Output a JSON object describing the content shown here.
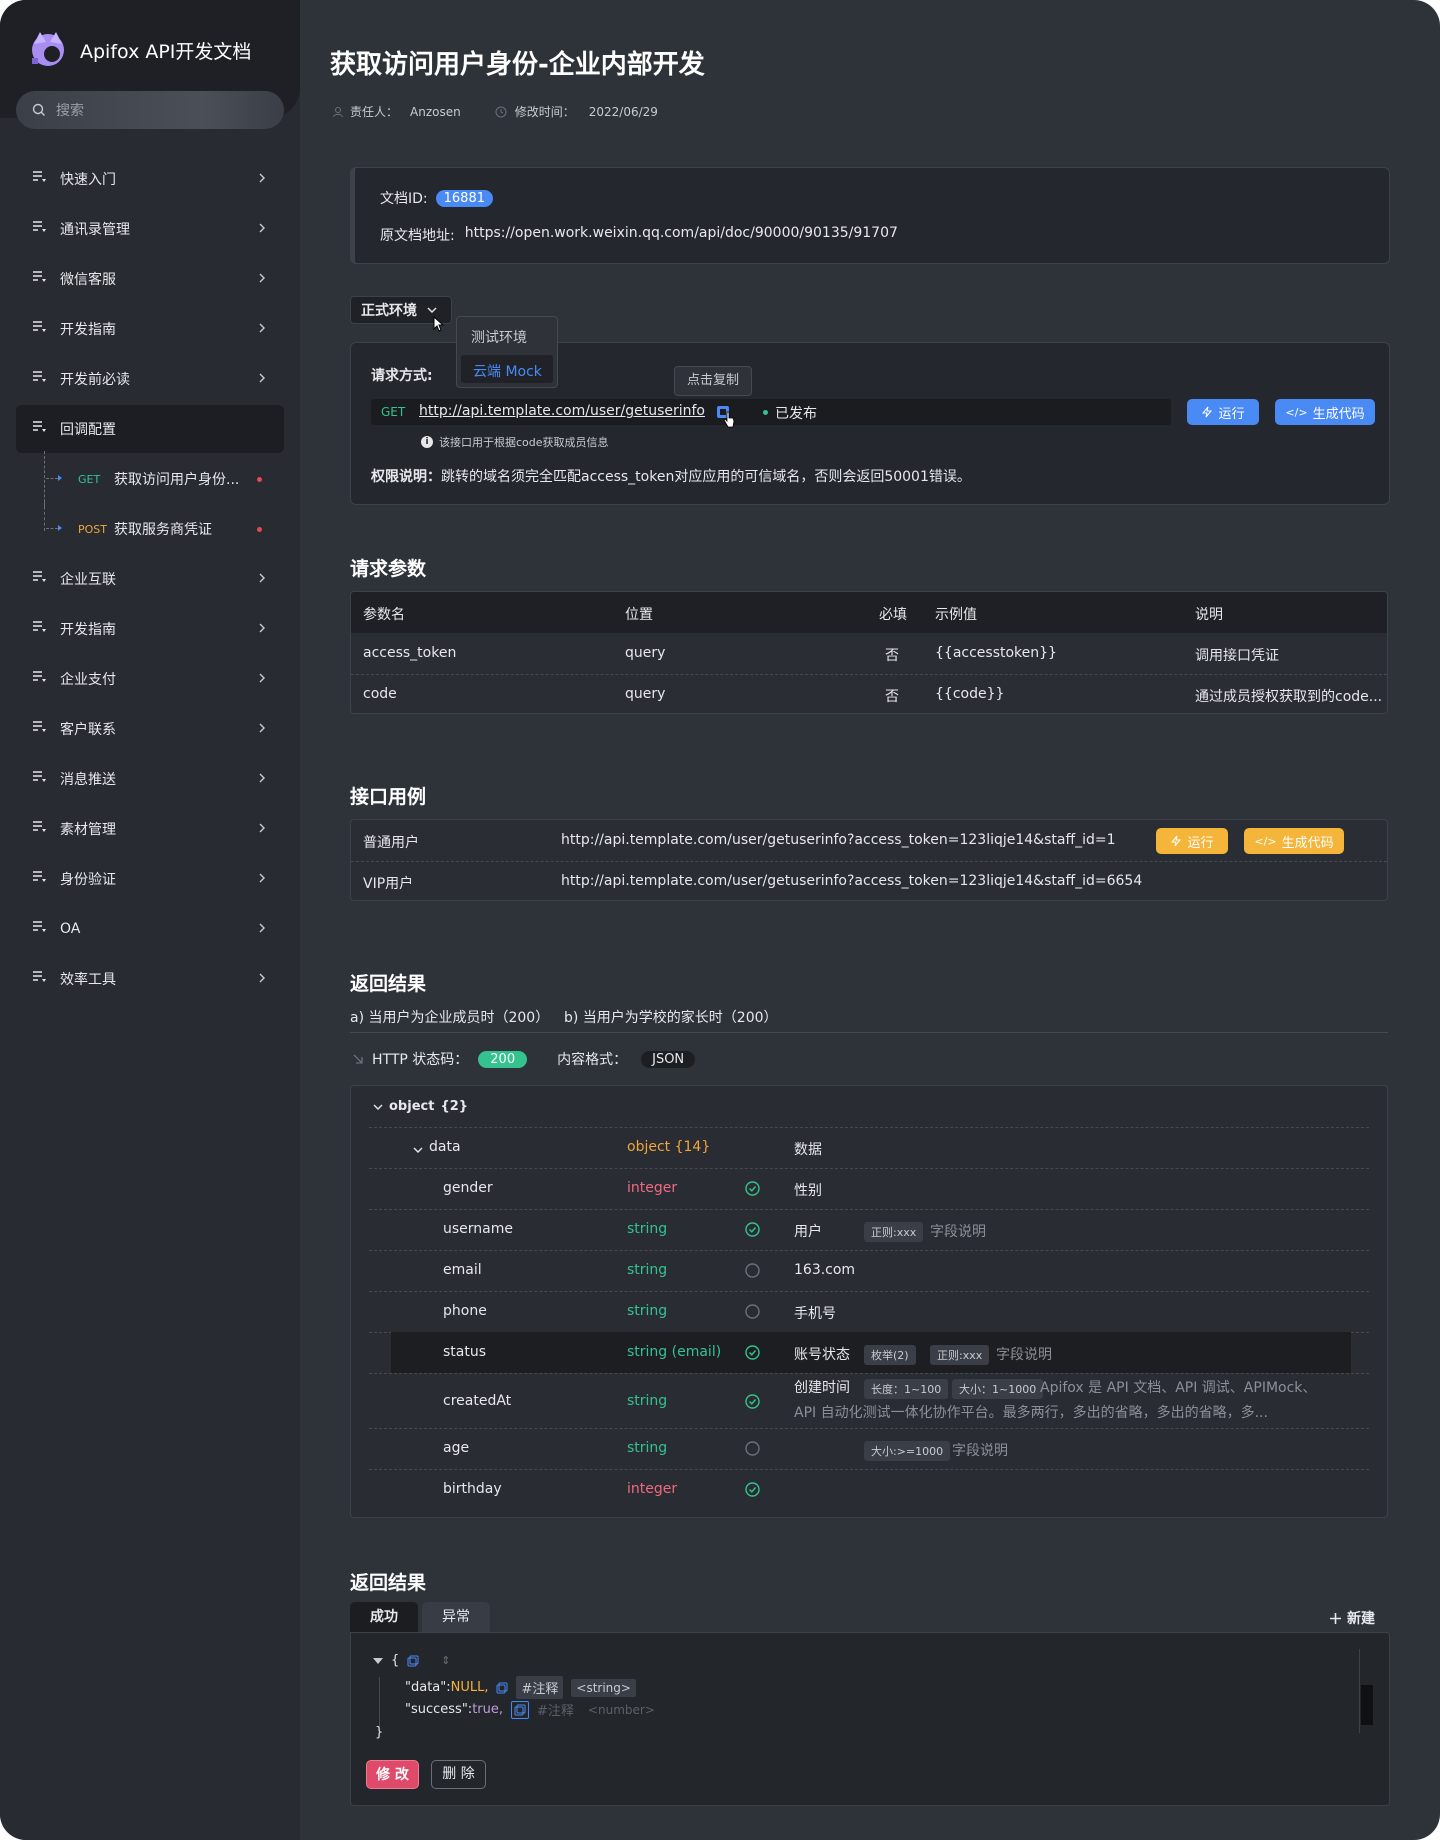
{
  "app": {
    "title": "Apifox API开发文档"
  },
  "search": {
    "placeholder": "搜索"
  },
  "sidebar": {
    "items": [
      {
        "label": "快速入门"
      },
      {
        "label": "通讯录管理"
      },
      {
        "label": "微信客服"
      },
      {
        "label": "开发指南"
      },
      {
        "label": "开发前必读"
      },
      {
        "label": "回调配置"
      },
      {
        "label": "企业互联"
      },
      {
        "label": "开发指南"
      },
      {
        "label": "企业支付"
      },
      {
        "label": "客户联系"
      },
      {
        "label": "消息推送"
      },
      {
        "label": "素材管理"
      },
      {
        "label": "身份验证"
      },
      {
        "label": "OA"
      },
      {
        "label": "效率工具"
      }
    ],
    "sub_items": [
      {
        "method": "GET",
        "label": "获取访问用户身份..."
      },
      {
        "method": "POST",
        "label": "获取服务商凭证"
      }
    ]
  },
  "page": {
    "title": "获取访问用户身份-企业内部开发",
    "owner_label": "责任人：",
    "owner": "Anzosen",
    "modified_label": "修改时间：",
    "modified": "2022/06/29"
  },
  "doc_info": {
    "id_label": "文档ID:",
    "id": "16881",
    "url_label": "原文档地址:",
    "url": "https://open.work.weixin.qq.com/api/doc/90000/90135/91707"
  },
  "env": {
    "selected": "正式环境",
    "options": [
      "测试环境",
      "云端 Mock"
    ]
  },
  "request": {
    "method_label": "请求方式:",
    "method": "GET",
    "url": "http://api.template.com/user/getuserinfo",
    "copy_tooltip": "点击复制",
    "status": "已发布",
    "run": "运行",
    "gen_code": "生成代码",
    "note": "该接口用于根据code获取成员信息",
    "perm_label": "权限说明：",
    "perm_text": "跳转的域名须完全匹配access_token对应应用的可信域名，否则会返回50001错误。"
  },
  "params": {
    "title": "请求参数",
    "headers": [
      "参数名",
      "位置",
      "必填",
      "示例值",
      "说明"
    ],
    "rows": [
      [
        "access_token",
        "query",
        "否",
        "{{accesstoken}}",
        "调用接口凭证"
      ],
      [
        "code",
        "query",
        "否",
        "{{code}}",
        "通过成员授权获取到的code..."
      ]
    ]
  },
  "examples": {
    "title": "接口用例",
    "rows": [
      {
        "name": "普通用户",
        "url": "http://api.template.com/user/getuserinfo?access_token=123liqje14&staff_id=1"
      },
      {
        "name": "VIP用户",
        "url": "http://api.template.com/user/getuserinfo?access_token=123liqje14&staff_id=6654"
      }
    ],
    "run": "运行",
    "gen_code": "生成代码"
  },
  "response": {
    "title": "返回结果",
    "tabs": [
      "a) 当用户为企业成员时（200）",
      "b) 当用户为学校的家长时（200）"
    ],
    "status_label": "HTTP 状态码：",
    "status": "200",
    "format_label": "内容格式：",
    "format": "JSON",
    "root": "object",
    "root_count": "{2}",
    "fields": [
      {
        "name": "data",
        "type": "object {14}",
        "type_color": "orange",
        "required": null,
        "desc": "数据",
        "tags": [],
        "note": ""
      },
      {
        "name": "gender",
        "type": "integer",
        "type_color": "red",
        "required": true,
        "desc": "性别",
        "tags": [],
        "note": ""
      },
      {
        "name": "username",
        "type": "string",
        "type_color": "green",
        "required": true,
        "desc": "用户",
        "tags": [
          "正则:xxx"
        ],
        "note": "字段说明"
      },
      {
        "name": "email",
        "type": "string",
        "type_color": "green",
        "required": false,
        "desc": "163.com",
        "tags": [],
        "note": ""
      },
      {
        "name": "phone",
        "type": "string",
        "type_color": "green",
        "required": false,
        "desc": "手机号",
        "tags": [],
        "note": ""
      },
      {
        "name": "status",
        "type": "string (email)",
        "type_color": "green",
        "required": true,
        "desc": "账号状态",
        "tags": [
          "枚举(2)",
          "正则:xxx"
        ],
        "note": "字段说明"
      },
      {
        "name": "createdAt",
        "type": "string",
        "type_color": "green",
        "required": true,
        "desc": "创建时间",
        "tags": [
          "长度：1~100",
          "大小：1~1000"
        ],
        "note": "Apifox 是 API 文档、API 调试、APIMock、",
        "note2": "API 自动化测试一体化协作平台。最多两行，多出的省略，多出的省略，多..."
      },
      {
        "name": "age",
        "type": "string",
        "type_color": "green",
        "required": false,
        "desc": "",
        "tags": [
          "大小:>=1000"
        ],
        "note": "字段说明"
      },
      {
        "name": "birthday",
        "type": "integer",
        "type_color": "red",
        "required": true,
        "desc": "",
        "tags": [],
        "note": ""
      }
    ]
  },
  "result": {
    "title": "返回结果",
    "tabs": [
      "成功",
      "异常"
    ],
    "new": "新建",
    "code": {
      "open": "{",
      "line1_key": "\"data\":",
      "line1_val": "NULL,",
      "line1_comment": "#注释",
      "line1_type": "<string>",
      "line2_key": "\"success\":",
      "line2_val": "true,",
      "line2_comment": "#注释",
      "line2_type": "<number>",
      "close": "}"
    },
    "edit": "修 改",
    "delete": "删 除"
  },
  "colors": {
    "accent": "#4a8af4",
    "warn": "#f5b43a",
    "ok": "#34c38f",
    "danger": "#e04a6a"
  }
}
